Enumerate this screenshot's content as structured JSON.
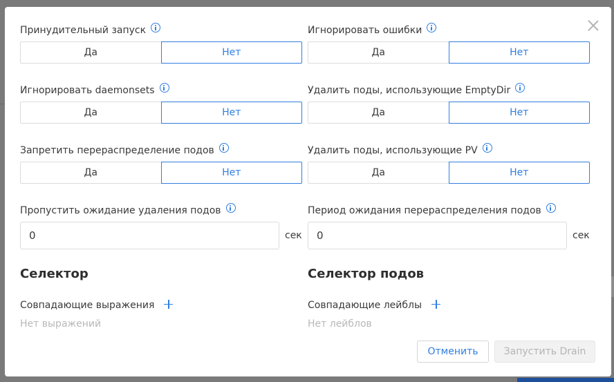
{
  "modal": {
    "close_icon": "close-icon",
    "toggles": [
      {
        "label": "Принудительный запуск",
        "yes": "Да",
        "no": "Нет",
        "selected": "Нет"
      },
      {
        "label": "Игнорировать ошибки",
        "yes": "Да",
        "no": "Нет",
        "selected": "Нет"
      },
      {
        "label": "Игнорировать daemonsets",
        "yes": "Да",
        "no": "Нет",
        "selected": "Нет"
      },
      {
        "label": "Удалить поды, использующие EmptyDir",
        "yes": "Да",
        "no": "Нет",
        "selected": "Нет"
      },
      {
        "label": "Запретить перераспределение подов",
        "yes": "Да",
        "no": "Нет",
        "selected": "Нет"
      },
      {
        "label": "Удалить поды, использующие PV",
        "yes": "Да",
        "no": "Нет",
        "selected": "Нет"
      }
    ],
    "numbers": [
      {
        "label": "Пропустить ожидание удаления подов",
        "value": "0",
        "unit": "сек"
      },
      {
        "label": "Период ожидания перераспределения подов",
        "value": "0",
        "unit": "сек"
      }
    ],
    "selector": {
      "title": "Селектор",
      "sub_label": "Совпадающие выражения",
      "empty": "Нет выражений"
    },
    "pod_selector": {
      "title": "Селектор подов",
      "sub_label": "Совпадающие лейблы",
      "empty": "Нет лейблов"
    },
    "buttons": {
      "cancel": "Отменить",
      "run": "Запустить Drain"
    },
    "colors": {
      "accent": "#2f7ee0",
      "overlay": "#7d7d7d",
      "muted": "#b8b8b8"
    }
  }
}
